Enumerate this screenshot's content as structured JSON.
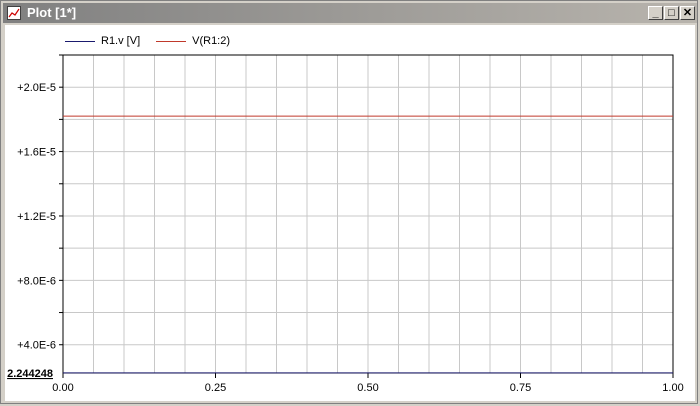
{
  "window": {
    "title": "Plot [1*]",
    "buttons": {
      "minimize": "_",
      "maximize": "□",
      "close": "✕"
    }
  },
  "chart_data": {
    "type": "line",
    "title": "",
    "xlabel": "",
    "ylabel": "",
    "xlim": [
      0,
      1
    ],
    "ylim": [
      2.244248e-06,
      2.2e-05
    ],
    "grid": true,
    "legend_position": "top-left",
    "x_ticks": [
      {
        "value": 0,
        "label": "0.00"
      },
      {
        "value": 0.25,
        "label": "0.25"
      },
      {
        "value": 0.5,
        "label": "0.50"
      },
      {
        "value": 0.75,
        "label": "0.75"
      },
      {
        "value": 1,
        "label": "1.00"
      }
    ],
    "y_ticks": [
      {
        "value": 4e-06,
        "label": "+4.0E-6"
      },
      {
        "value": 8e-06,
        "label": "+8.0E-6"
      },
      {
        "value": 1.2e-05,
        "label": "+1.2E-5"
      },
      {
        "value": 1.6e-05,
        "label": "+1.6E-5"
      },
      {
        "value": 2e-05,
        "label": "+2.0E-5"
      }
    ],
    "y_min_label": "2.244248",
    "series": [
      {
        "name": "R1.v [V]",
        "color": "#1a1a6e",
        "x": [
          0,
          1
        ],
        "y": [
          2.25e-06,
          2.25e-06
        ]
      },
      {
        "name": "V(R1:2)",
        "color": "#c0392b",
        "x": [
          0,
          1
        ],
        "y": [
          1.82e-05,
          1.82e-05
        ]
      }
    ]
  }
}
